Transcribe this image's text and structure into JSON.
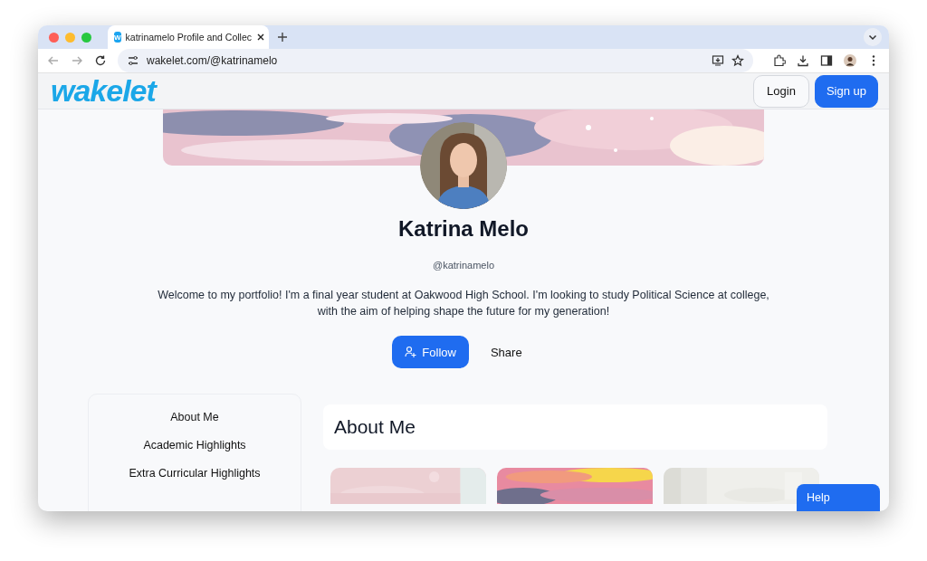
{
  "browser": {
    "tab_title": "katrinamelo Profile and Collec",
    "tab_icon": "W",
    "url": "wakelet.com/@katrinamelo"
  },
  "header": {
    "logo": "wakelet",
    "buttons": [
      {
        "label": "Login",
        "kind": "secondary"
      },
      {
        "label": "Sign up",
        "kind": "primary"
      }
    ]
  },
  "profile": {
    "name": "Katrina Melo",
    "handle": "@katrinamelo",
    "bio": "Welcome to my portfolio! I'm a final year student at Oakwood High School. I'm looking to study Political Science at college, with the aim of helping shape the future for my generation!",
    "actions": [
      {
        "label": "Follow",
        "kind": "primary"
      },
      {
        "label": "Share",
        "kind": "plain"
      }
    ]
  },
  "sidebar": {
    "items": [
      {
        "label": "About Me"
      },
      {
        "label": "Academic Highlights"
      },
      {
        "label": "Extra Curricular Highlights"
      }
    ]
  },
  "section": {
    "title": "About Me"
  },
  "help": {
    "label": "Help"
  }
}
